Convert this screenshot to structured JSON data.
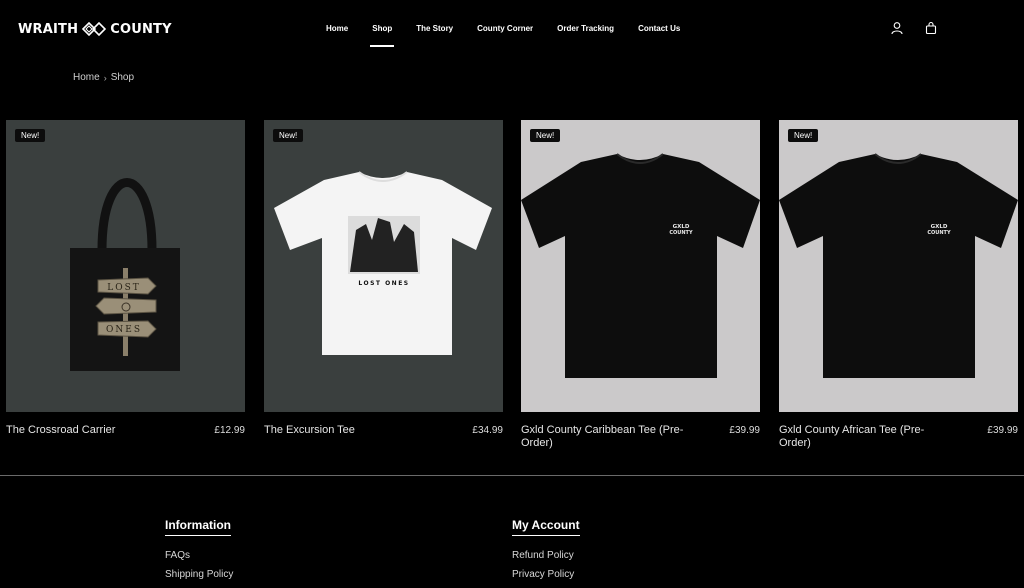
{
  "brand": {
    "left": "WRAITH",
    "right": "COUNTY"
  },
  "nav": [
    {
      "label": "Home",
      "active": false
    },
    {
      "label": "Shop",
      "active": true
    },
    {
      "label": "The Story",
      "active": false
    },
    {
      "label": "County Corner",
      "active": false
    },
    {
      "label": "Order Tracking",
      "active": false
    },
    {
      "label": "Contact Us",
      "active": false
    }
  ],
  "header_icons": [
    "user-icon",
    "bag-icon"
  ],
  "breadcrumb": {
    "home": "Home",
    "separator": "›",
    "current": "Shop"
  },
  "products": [
    {
      "name": "The Crossroad Carrier",
      "price": "£12.99",
      "badge": "New!",
      "image": "tote-bag-image",
      "bg": "#3a3f3e",
      "art": {
        "sign_top": "LOST",
        "sign_bottom": "ONES"
      }
    },
    {
      "name": "The Excursion Tee",
      "price": "£34.99",
      "badge": "New!",
      "image": "white-tshirt-image",
      "bg": "#3a3f3e",
      "art": {
        "print_text": "LOST ONES"
      }
    },
    {
      "name": "Gxld County Caribbean Tee (Pre-Order)",
      "price": "£39.99",
      "badge": "New!",
      "image": "black-tshirt-image",
      "bg": "#cbc9ca",
      "art": {
        "logo_top": "GXLD",
        "logo_bottom": "COUNTY"
      }
    },
    {
      "name": "Gxld County African Tee (Pre-Order)",
      "price": "£39.99",
      "badge": "New!",
      "image": "black-tshirt-image",
      "bg": "#cbc9ca",
      "art": {
        "logo_top": "GXLD",
        "logo_bottom": "COUNTY"
      }
    }
  ],
  "footer": {
    "information": {
      "heading": "Information",
      "links": [
        "FAQs",
        "Shipping Policy"
      ]
    },
    "account": {
      "heading": "My Account",
      "links": [
        "Refund Policy",
        "Privacy Policy"
      ]
    }
  },
  "colors": {
    "background": "#000000",
    "text": "#ffffff",
    "card_dark": "#3a3f3e",
    "card_light": "#cbc9ca"
  }
}
